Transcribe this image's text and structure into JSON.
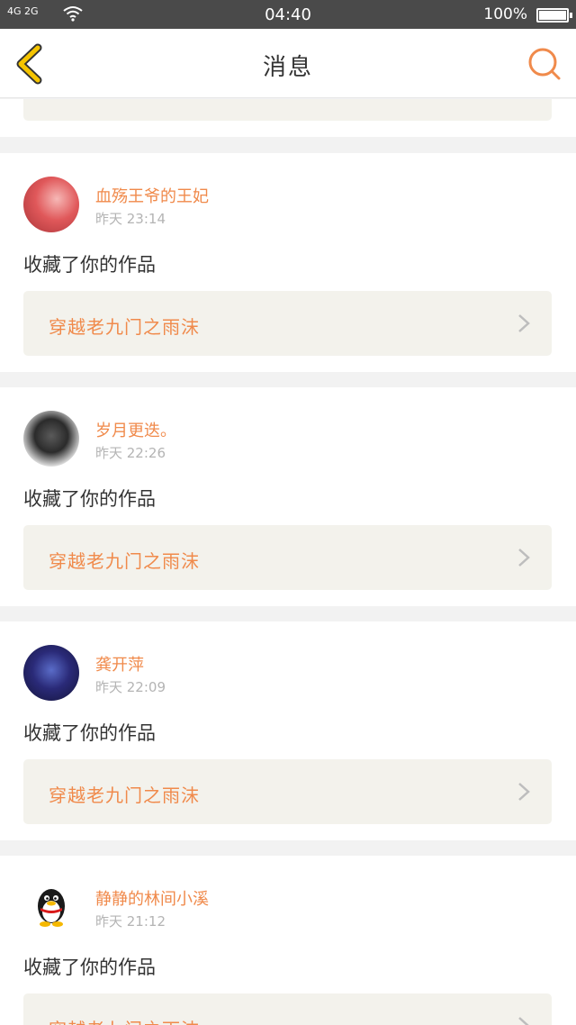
{
  "status_bar": {
    "signal": "4G 2G",
    "time": "04:40",
    "battery": "100%"
  },
  "nav": {
    "title": "消息"
  },
  "messages": [
    {
      "user": "血殇王爷的王妃",
      "time": "昨天 23:14",
      "action": "收藏了你的作品",
      "work_title": "穿越老九门之雨沫"
    },
    {
      "user": "岁月更迭。",
      "time": "昨天 22:26",
      "action": "收藏了你的作品",
      "work_title": "穿越老九门之雨沫"
    },
    {
      "user": "龚开萍",
      "time": "昨天 22:09",
      "action": "收藏了你的作品",
      "work_title": "穿越老九门之雨沫"
    },
    {
      "user": "静静的林间小溪",
      "time": "昨天 21:12",
      "action": "收藏了你的作品",
      "work_title": "穿越老九门之雨沫"
    }
  ],
  "colors": {
    "accent": "#f08a4b",
    "back_icon": "#f5c400",
    "card_box": "#f3f2ec"
  },
  "icons": [
    "back-arrow-icon",
    "search-icon",
    "chevron-right-icon",
    "wifi-icon",
    "battery-icon"
  ]
}
